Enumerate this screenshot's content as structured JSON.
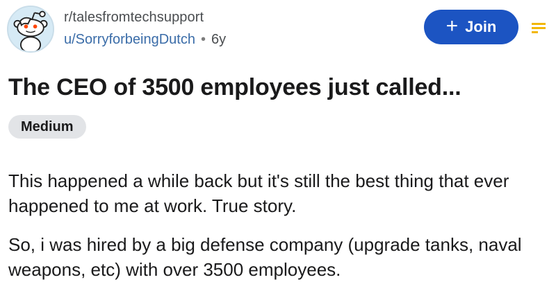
{
  "post": {
    "subreddit": "r/talesfromtechsupport",
    "author": "u/SorryforbeingDutch",
    "separator": "•",
    "age": "6y",
    "join_label": "Join",
    "join_plus": "+",
    "title": "The CEO of 3500 employees just called...",
    "flair": "Medium",
    "paragraphs": [
      "This happened a while back but it's still the best thing that ever happened to me at work. True story.",
      "So, i was hired by a big defense company (upgrade tanks, naval weapons, etc) with over 3500 employees."
    ]
  },
  "icons": {
    "avatar": "reddit-snoo-avatar-icon",
    "join": "plus-icon",
    "menu": "sort-menu-icon"
  },
  "colors": {
    "join_button": "#1c54c2",
    "username": "#3a6ca8",
    "flair_bg": "#e2e4e7",
    "menu_icon": "#f2b705"
  }
}
